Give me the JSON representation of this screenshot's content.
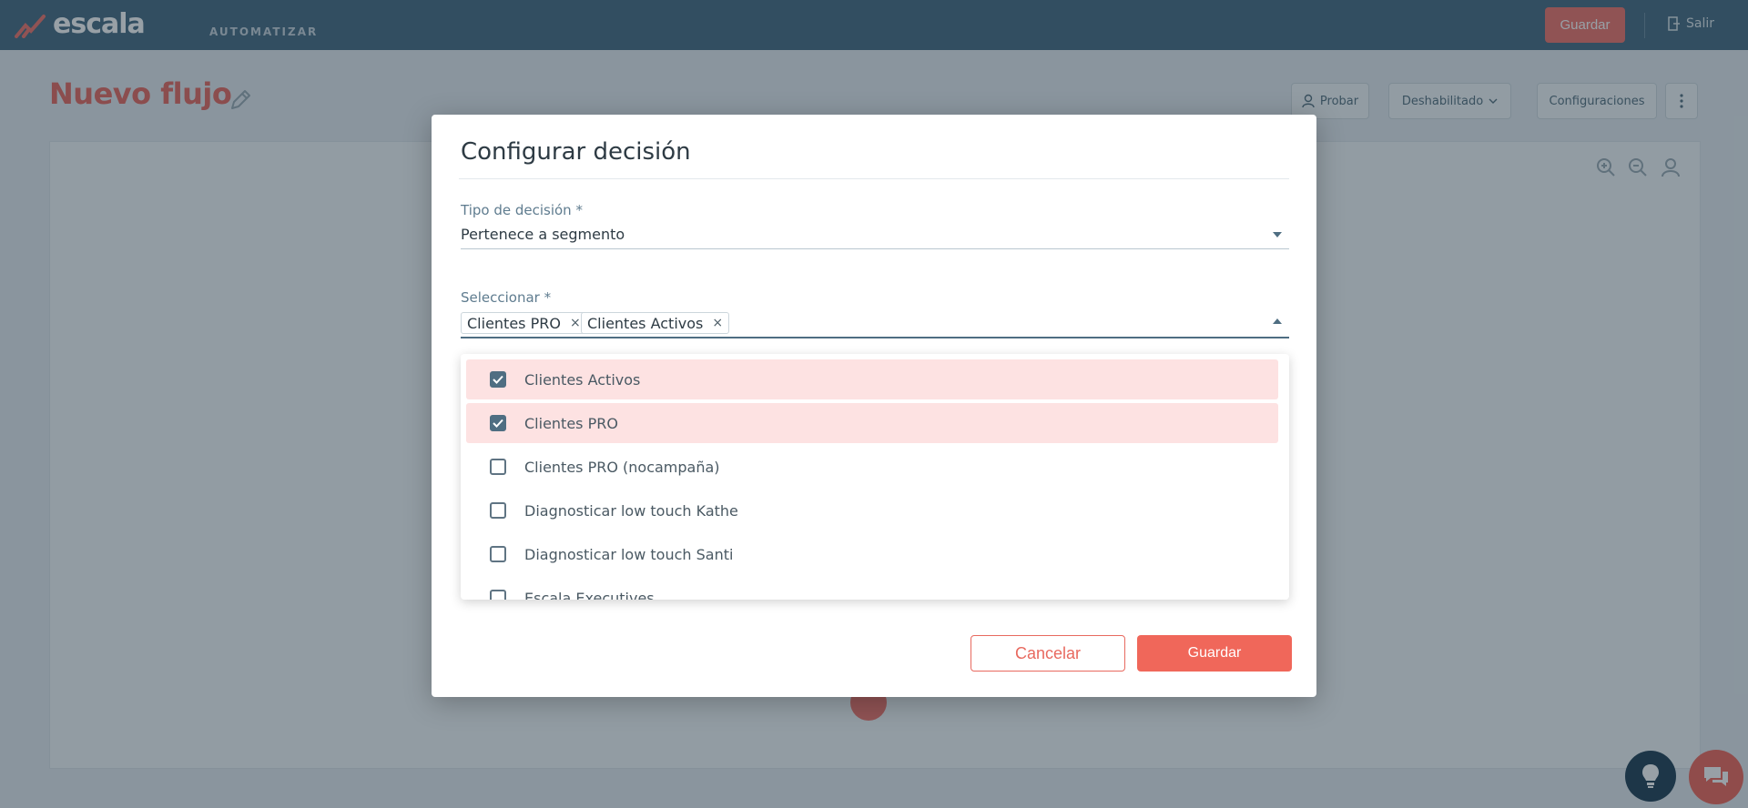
{
  "app": {
    "brand": "escala",
    "module": "AUTOMATIZAR",
    "save_label": "Guardar",
    "exit_label": "Salir"
  },
  "page": {
    "title": "Nuevo flujo",
    "toolbar": {
      "test_label": "Probar",
      "status_label": "Deshabilitado",
      "settings_label": "Configuraciones"
    }
  },
  "modal": {
    "title": "Configurar decisión",
    "decision_type": {
      "label": "Tipo de decisión",
      "required_mark": "*",
      "value": "Pertenece a segmento"
    },
    "select": {
      "label": "Seleccionar",
      "required_mark": "*",
      "chips": [
        "Clientes PRO",
        "Clientes Activos"
      ],
      "remove_glyph": "×"
    },
    "options": [
      {
        "label": "Clientes Activos",
        "checked": true
      },
      {
        "label": "Clientes PRO",
        "checked": true
      },
      {
        "label": "Clientes PRO (nocampaña)",
        "checked": false
      },
      {
        "label": "Diagnosticar low touch Kathe",
        "checked": false
      },
      {
        "label": "Diagnosticar low touch Santi",
        "checked": false
      },
      {
        "label": "Escala Executives",
        "checked": false
      }
    ],
    "cancel_label": "Cancelar",
    "save_label": "Guardar"
  },
  "colors": {
    "topbar": "#466a82",
    "accent": "#f0675a",
    "selected_row": "#fde2e2",
    "checkbox": "#4f6e82"
  },
  "icons": [
    "escala-logo-icon",
    "edit-pencil-icon",
    "user-icon",
    "chevron-down-icon",
    "more-vert-icon",
    "zoom-in-icon",
    "zoom-out-icon",
    "exit-icon",
    "lightbulb-icon",
    "chat-icon",
    "check-icon",
    "close-icon"
  ]
}
